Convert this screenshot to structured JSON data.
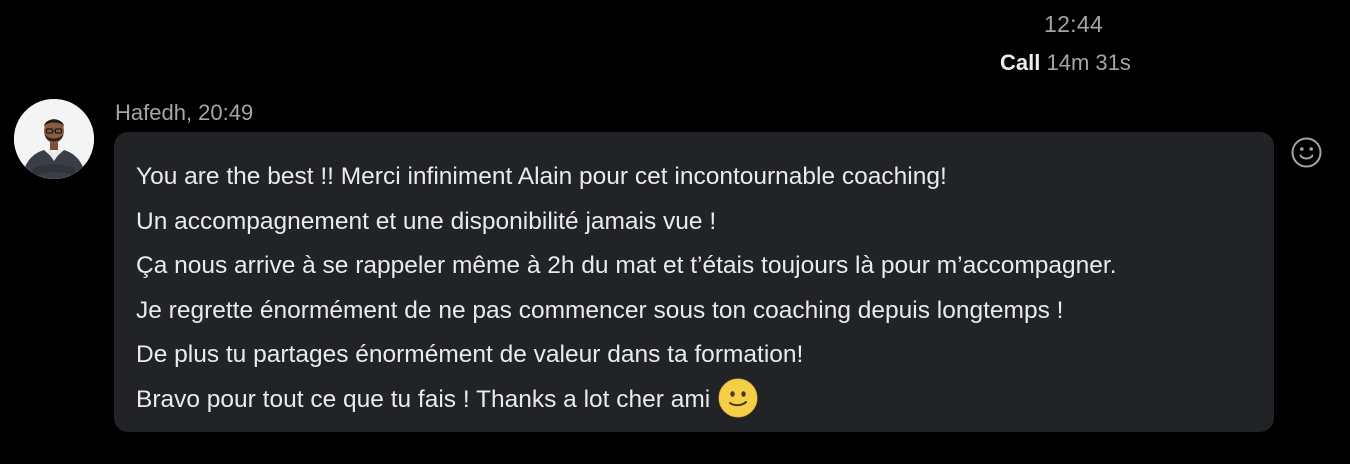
{
  "call": {
    "time": "12:44",
    "label": "Call",
    "duration": "14m 31s"
  },
  "message": {
    "sender": "Hafedh, 20:49",
    "lines": [
      "You are the best !! Merci infiniment Alain pour cet incontournable coaching!",
      "Un accompagnement et une disponibilité jamais vue !",
      "Ça nous arrive à se rappeler même à 2h du mat et t’étais toujours là pour m’accompagner.",
      "Je regrette énormément de ne pas commencer sous ton coaching depuis longtemps !",
      "De plus tu partages énormément de valeur dans ta formation!",
      "Bravo pour tout ce que tu fais ! Thanks a lot cher ami"
    ],
    "emoji_icon": "slightly-smiling-face-icon"
  },
  "icons": {
    "avatar": "user-avatar",
    "react": "add-reaction-smiley-icon"
  },
  "colors": {
    "background": "#000000",
    "bubble": "#212326",
    "text": "#e9eaeb",
    "muted": "#a2a5a9",
    "emoji": "#f5cf45"
  }
}
